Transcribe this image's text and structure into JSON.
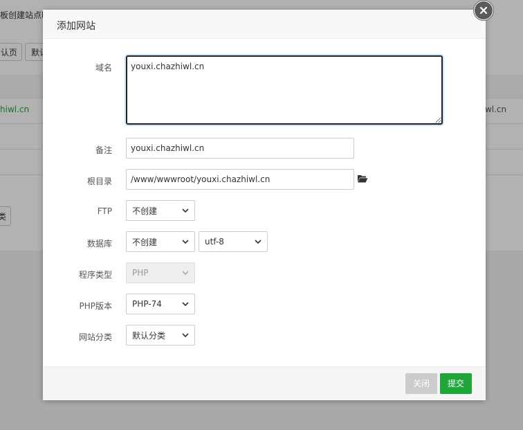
{
  "background": {
    "header_text": "板创建站点时",
    "buttons": [
      "认页",
      "默认"
    ],
    "site_left": "hiwl.cn",
    "site_right": "hiwl.cn",
    "lower_button": "类"
  },
  "modal": {
    "title": "添加网站",
    "fields": {
      "domain": {
        "label": "域名",
        "value": "youxi.chazhiwl.cn"
      },
      "note": {
        "label": "备注",
        "value": "youxi.chazhiwl.cn"
      },
      "root": {
        "label": "根目录",
        "value": "/www/wwwroot/youxi.chazhiwl.cn"
      },
      "ftp": {
        "label": "FTP",
        "selected": "不创建"
      },
      "database": {
        "label": "数据库",
        "selected": "不创建",
        "charset": "utf-8"
      },
      "program_type": {
        "label": "程序类型",
        "selected": "PHP"
      },
      "php_version": {
        "label": "PHP版本",
        "selected": "PHP-74"
      },
      "category": {
        "label": "网站分类",
        "selected": "默认分类"
      }
    },
    "footer": {
      "close_label": "关闭",
      "submit_label": "提交"
    }
  },
  "colors": {
    "accent": "#20a53a",
    "close_button": "#cccccc"
  },
  "icons": {
    "folder": "folder-open-icon",
    "dialog_close": "close-icon"
  }
}
